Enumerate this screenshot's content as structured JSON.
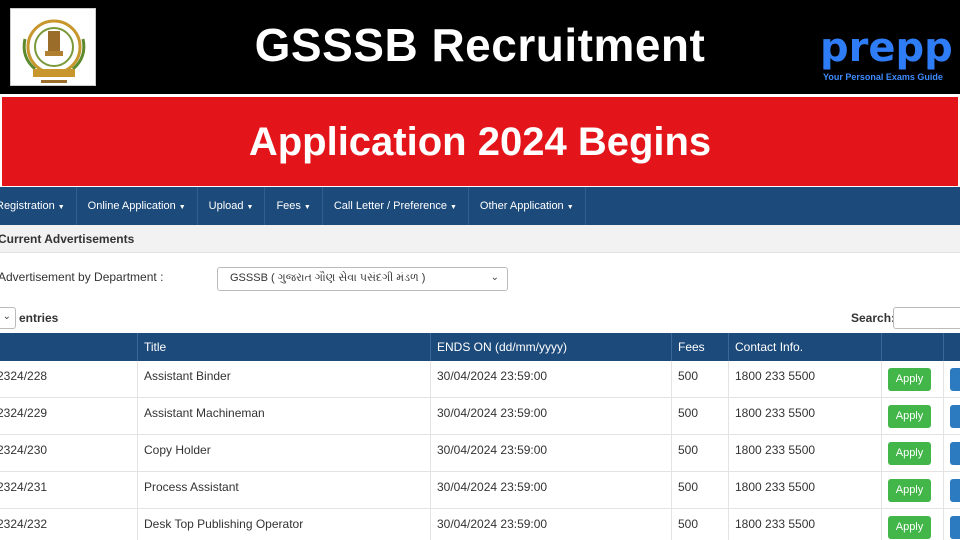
{
  "header": {
    "title": "GSSSB Recruitment",
    "brand": "Prepp",
    "brand_tagline": "Your Personal Exams Guide",
    "emblem": "gsssb-emblem-icon"
  },
  "banner": {
    "subtitle": "Application 2024 Begins",
    "color": "#e3151a"
  },
  "nav": {
    "items": [
      {
        "label": "Registration",
        "key": "registration"
      },
      {
        "label": "Online Application",
        "key": "online-application"
      },
      {
        "label": "Upload",
        "key": "upload"
      },
      {
        "label": "Fees",
        "key": "fees"
      },
      {
        "label": "Call Letter / Preference",
        "key": "call-letter"
      },
      {
        "label": "Other Application",
        "key": "other-application"
      }
    ],
    "color": "#1c4a7a"
  },
  "section": {
    "title": "Current Advertisements"
  },
  "filter": {
    "label": "Advertisement by Department :",
    "selected": "GSSSB ( ગુજરાત ગૌણ સેવા પસંદગી મંડળ )"
  },
  "table_controls": {
    "entries_label": "entries",
    "search_label": "Search:"
  },
  "table": {
    "columns": [
      "Title",
      "ENDS ON (dd/mm/yyyy)",
      "Fees",
      "Contact Info."
    ],
    "apply_label": "Apply",
    "rows": [
      {
        "adv_no": "2324/228",
        "title": "Assistant Binder",
        "ends_on": "30/04/2024 23:59:00",
        "fees": "500",
        "contact": "1800 233 5500"
      },
      {
        "adv_no": "2324/229",
        "title": "Assistant Machineman",
        "ends_on": "30/04/2024 23:59:00",
        "fees": "500",
        "contact": "1800 233 5500"
      },
      {
        "adv_no": "2324/230",
        "title": "Copy Holder",
        "ends_on": "30/04/2024 23:59:00",
        "fees": "500",
        "contact": "1800 233 5500"
      },
      {
        "adv_no": "2324/231",
        "title": "Process Assistant",
        "ends_on": "30/04/2024 23:59:00",
        "fees": "500",
        "contact": "1800 233 5500"
      },
      {
        "adv_no": "2324/232",
        "title": "Desk Top Publishing Operator",
        "ends_on": "30/04/2024 23:59:00",
        "fees": "500",
        "contact": "1800 233 5500"
      }
    ]
  },
  "colors": {
    "apply_green": "#43b649",
    "action_blue": "#2c7ac0"
  }
}
